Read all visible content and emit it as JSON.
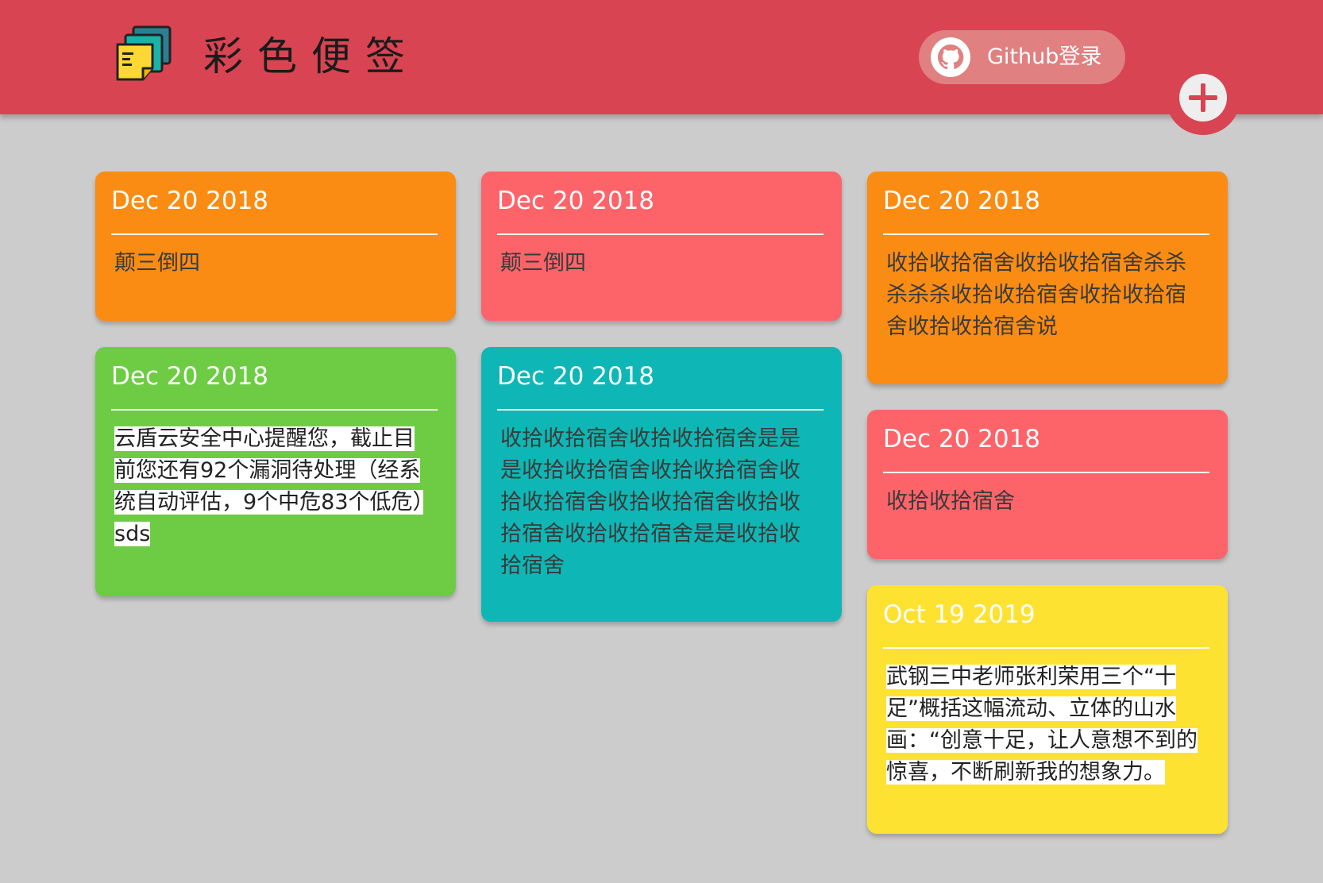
{
  "header": {
    "title": "彩色便签",
    "login_label": "Github登录",
    "colors": {
      "bar": "#d94452"
    }
  },
  "notes": [
    {
      "date": "Dec 20 2018",
      "text": "颠三倒四",
      "color": "#fa8c13"
    },
    {
      "date": "Dec 20 2018",
      "text": "云盾云安全中心提醒您，截止目前您还有92个漏洞待处理（经系统自动评估，9个中危83个低危）sds",
      "color": "#6ecc44"
    },
    {
      "date": "Dec 20 2018",
      "text": "颠三倒四",
      "color": "#fd646a"
    },
    {
      "date": "Dec 20 2018",
      "text": "收拾收拾宿舍收拾收拾宿舍是是是收拾收拾宿舍收拾收拾宿舍收拾收拾宿舍收拾收拾宿舍收拾收拾宿舍收拾收拾宿舍是是收拾收拾宿舍",
      "color": "#0eb7b5"
    },
    {
      "date": "Dec 20 2018",
      "text": "收拾收拾宿舍收拾收拾宿舍杀杀杀杀杀收拾收拾宿舍收拾收拾宿舍收拾收拾宿舍说",
      "color": "#fa8c13"
    },
    {
      "date": "Dec 20 2018",
      "text": "收拾收拾宿舍",
      "color": "#fd646a"
    },
    {
      "date": "Oct 19 2019",
      "text": "武钢三中老师张利荣用三个“十足”概括这幅流动、立体的山水画：“创意十足，让人意想不到的惊喜，不断刷新我的想象力。",
      "color": "#fee232"
    }
  ]
}
